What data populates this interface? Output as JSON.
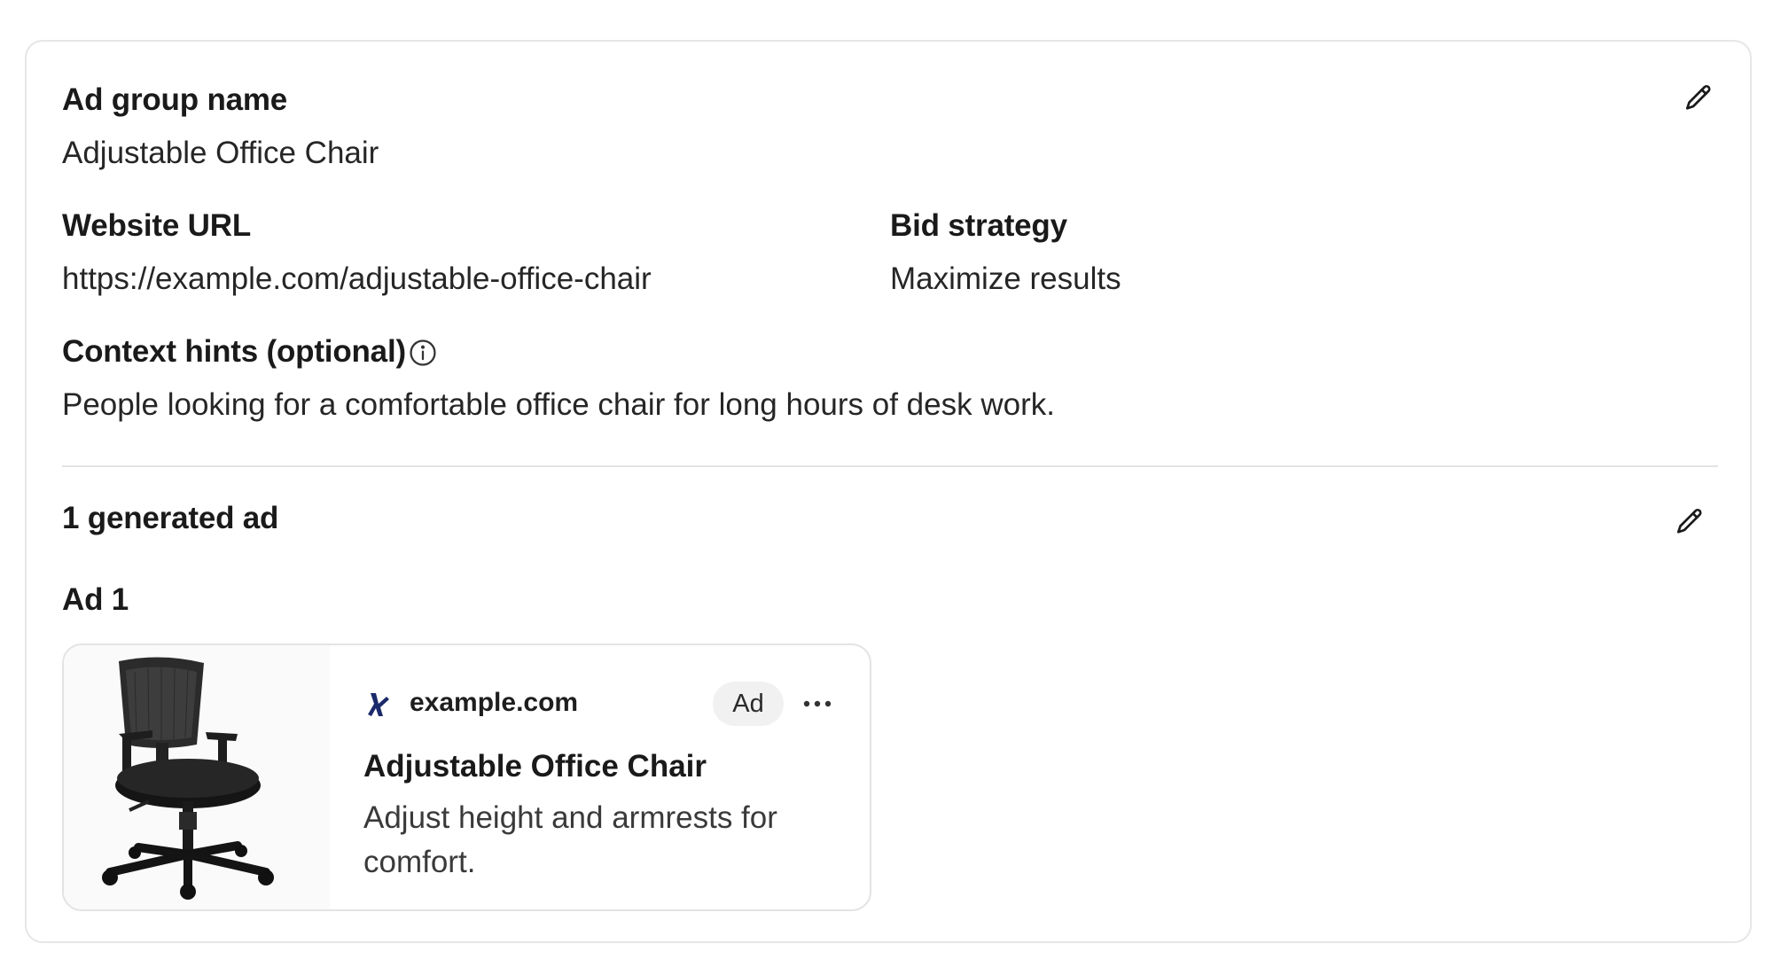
{
  "ad_group": {
    "name_label": "Ad group name",
    "name_value": "Adjustable Office Chair",
    "website_label": "Website URL",
    "website_value": "https://example.com/adjustable-office-chair",
    "bid_label": "Bid strategy",
    "bid_value": "Maximize results",
    "context_label": "Context hints (optional)",
    "context_value": "People looking for a comfortable office chair for long hours of desk work."
  },
  "generated": {
    "count_label": "1 generated ad",
    "ad_title": "Ad 1"
  },
  "ad_preview": {
    "domain": "example.com",
    "badge": "Ad",
    "headline": "Adjustable Office Chair",
    "description": "Adjust height and armrests for comfort."
  },
  "icons": {
    "edit": "pencil-icon",
    "info": "info-icon",
    "more": "ellipsis-icon",
    "favicon": "brand-favicon",
    "product": "office-chair-image"
  },
  "colors": {
    "border": "#e6e6e6",
    "divider": "#e3e3e3",
    "badge_bg": "#f1f1f1",
    "favicon": "#1b2a6b"
  }
}
